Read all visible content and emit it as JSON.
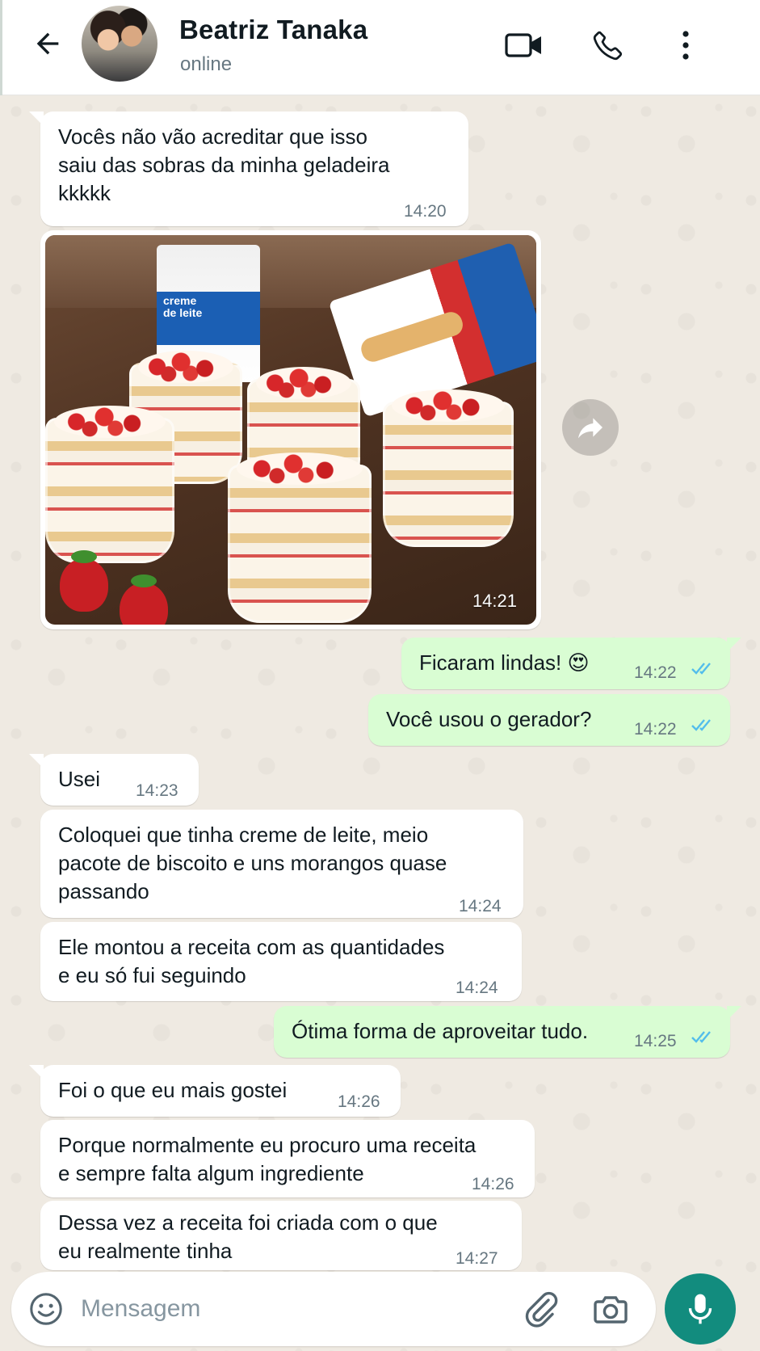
{
  "header": {
    "contact_name": "Beatriz Tanaka",
    "status": "online",
    "icons": [
      "back-arrow-icon",
      "video-call-icon",
      "voice-call-icon",
      "more-options-icon"
    ]
  },
  "messages": [
    {
      "direction": "in",
      "text": "Vocês não vão acreditar que isso\nsaiu das sobras da minha geladeira\nkkkkk",
      "time": "14:20"
    },
    {
      "direction": "in",
      "type": "image",
      "image_description": "photo",
      "time": "14:21",
      "carton_label": "creme\nde leite"
    },
    {
      "direction": "out",
      "text": "Ficaram lindas! 😍",
      "time": "14:22",
      "read": true
    },
    {
      "direction": "out",
      "text": "Você usou o gerador?",
      "time": "14:22",
      "read": true
    },
    {
      "direction": "in",
      "text": "Usei",
      "time": "14:23"
    },
    {
      "direction": "in",
      "text": "Coloquei que tinha creme de leite, meio\npacote de biscoito e uns morangos quase\npassando",
      "time": "14:24"
    },
    {
      "direction": "in",
      "text": "Ele montou a receita com as quantidades\ne eu só fui seguindo",
      "time": "14:24"
    },
    {
      "direction": "out",
      "text": "Ótima forma de aproveitar tudo.",
      "time": "14:25",
      "read": true
    },
    {
      "direction": "in",
      "text": "Foi o que eu mais gostei",
      "time": "14:26"
    },
    {
      "direction": "in",
      "text": "Porque normalmente eu procuro uma receita\ne sempre falta algum ingrediente",
      "time": "14:26"
    },
    {
      "direction": "in",
      "text": "Dessa vez a receita foi criada com o que\neu realmente tinha",
      "time": "14:27"
    }
  ],
  "composer": {
    "placeholder": "Mensagem",
    "icons": [
      "emoji-icon",
      "attach-icon",
      "camera-icon",
      "mic-icon"
    ]
  },
  "colors": {
    "header_bg": "#ffffff",
    "chat_bg": "#efeae2",
    "incoming_bubble": "#ffffff",
    "outgoing_bubble": "#d9fdd3",
    "read_ticks": "#53bdeb",
    "mic_button": "#128c7e"
  }
}
